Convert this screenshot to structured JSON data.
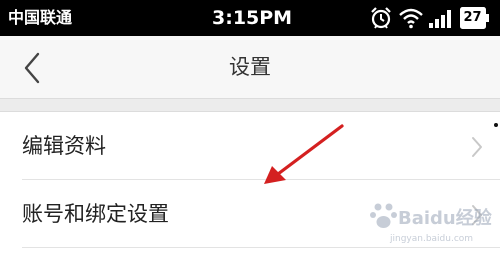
{
  "status_bar": {
    "carrier": "中国联通",
    "time": "3:15PM",
    "battery": "27",
    "icons": [
      "alarm-icon",
      "wifi-icon",
      "signal-icon",
      "battery-icon"
    ]
  },
  "nav": {
    "back_icon": "chevron-left-icon",
    "title": "设置"
  },
  "settings_items": [
    {
      "label": "编辑资料",
      "icon": "chevron-right-icon"
    },
    {
      "label": "账号和绑定设置",
      "icon": "chevron-right-icon"
    }
  ],
  "annotation": {
    "arrow_color": "#d42020"
  },
  "watermark": {
    "text": "Baidu经验",
    "url": "jingyan.baidu.com"
  },
  "colors": {
    "status_bar": "#000000",
    "nav_bar": "#f7f7f7",
    "section_gap": "#ececec"
  }
}
